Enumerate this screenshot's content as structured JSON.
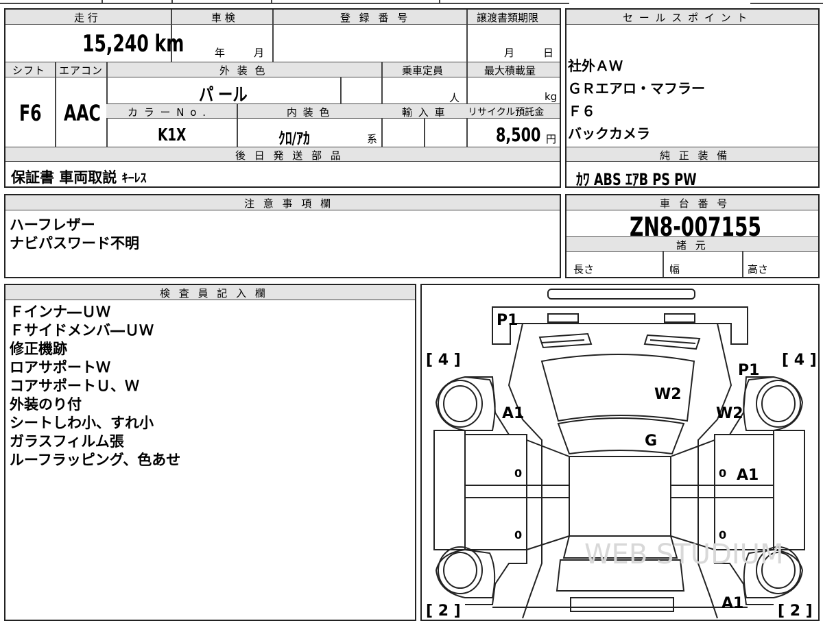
{
  "vehicle": {
    "mileage_label": "走 行",
    "mileage": "15,240",
    "mileage_unit": "km",
    "inspection_label": "車 検",
    "year_label": "年",
    "month_label": "月",
    "reg_label": "登 録 番 号",
    "transfer_label": "譲渡書類期限",
    "transfer_month": "月",
    "transfer_day": "日",
    "shift_label": "シフト",
    "ac_label": "エアコン",
    "color_label": "外 装 色",
    "capacity_label": "乗車定員",
    "load_label": "最大積載量",
    "shift": "F6",
    "ac": "AAC",
    "color": "パ ール",
    "capacity_unit": "人",
    "load_unit": "kg",
    "color_no_label": "カ ラ ー N o .",
    "interior_label": "内 装 色",
    "import_label": "輸 入 車",
    "recycle_label": "リサイクル預託金",
    "color_no": "K1X",
    "interior": "ｸﾛ/ｱｶ",
    "interior_suffix": "系",
    "recycle": "8,500",
    "recycle_unit": "円"
  },
  "later_parts": {
    "label": "後 日 発 送 部 品",
    "value_main": "保証書 車両取説",
    "value_small": "ｷｰﾚｽ"
  },
  "sales_points": {
    "label": "セ ー ル ス ポ イ ン ト",
    "items": [
      "社外ＡＷ",
      "ＧＲエアロ・マフラー",
      "Ｆ６",
      "バックカメラ"
    ]
  },
  "equipment": {
    "label": "純 正 装 備",
    "value": "ｶﾜ ABS ｴｱB PS PW"
  },
  "notes": {
    "label": "注 意 事 項 欄",
    "lines": [
      "ハーフレザー",
      "ナビパスワード不明"
    ]
  },
  "chassis": {
    "label": "車 台 番 号",
    "value": "ZN8-007155",
    "specs_label": "諸 元",
    "length_label": "長さ",
    "width_label": "幅",
    "height_label": "高さ"
  },
  "inspector": {
    "label": "検 査 員 記 入 欄",
    "lines": [
      "Ｆインナ―ＵＷ",
      "Ｆサイドメンバ―ＵＷ",
      "修正機跡",
      "ロアサポートＷ",
      "コアサポートＵ、Ｗ",
      "外装のり付",
      "シートしわ小、すれ小",
      "ガラスフィルム張",
      "ルーフラッピング、色あせ"
    ]
  },
  "diagram": {
    "marks": [
      "P1",
      "[ 4 ]",
      "[ 4 ]",
      "P1",
      "W2",
      "A1",
      "W2",
      "G",
      "A1",
      "0",
      "0",
      "0",
      "0",
      "[ 2 ]",
      "A1",
      "[ 2 ]"
    ],
    "watermark": "WEB STUDIUM"
  }
}
